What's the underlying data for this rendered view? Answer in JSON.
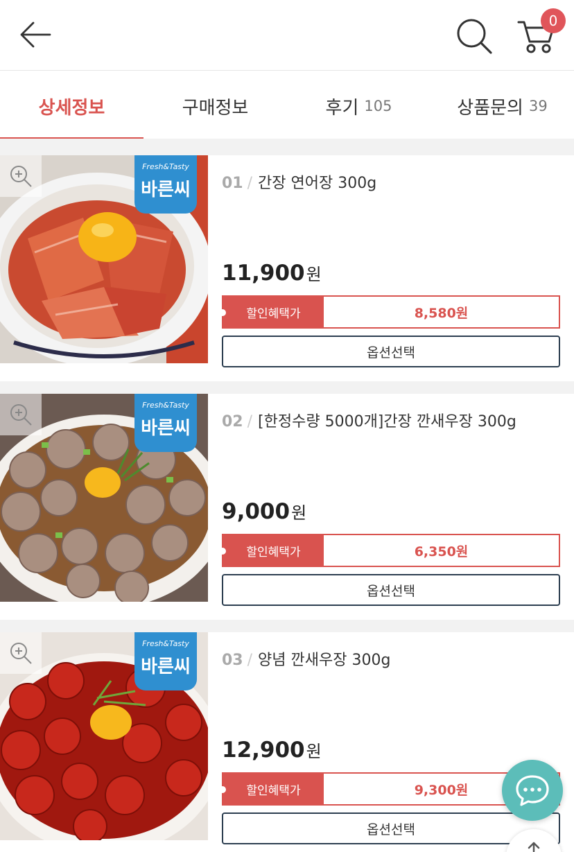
{
  "header": {
    "back_icon": "arrow-left-icon",
    "search_icon": "search-icon",
    "cart_icon": "cart-icon",
    "cart_count": "0"
  },
  "tabs": [
    {
      "label": "상세정보",
      "count": ""
    },
    {
      "label": "구매정보",
      "count": ""
    },
    {
      "label": "후기",
      "count": "105"
    },
    {
      "label": "상품문의",
      "count": "39"
    }
  ],
  "colors": {
    "accent": "#d9534f",
    "chat": "#5cbdb9",
    "brand": "#2f8fd0"
  },
  "products": [
    {
      "num": "01",
      "name": "간장 연어장 300g",
      "price": "11,900",
      "won": "원",
      "discount_label": "할인혜택가",
      "discount_price": "8,580원",
      "option_label": "옵션선택"
    },
    {
      "num": "02",
      "name": "[한정수량 5000개]간장 깐새우장 300g",
      "price": "9,000",
      "won": "원",
      "discount_label": "할인혜택가",
      "discount_price": "6,350원",
      "option_label": "옵션선택"
    },
    {
      "num": "03",
      "name": "양념 깐새우장 300g",
      "price": "12,900",
      "won": "원",
      "discount_label": "할인혜택가",
      "discount_price": "9,300원",
      "option_label": "옵션선택"
    }
  ],
  "brand_badge": {
    "small": "Fresh&Tasty",
    "big": "바른씨"
  },
  "floating": {
    "chat_icon": "chat-bubble-icon",
    "top_icon": "arrow-up-icon"
  }
}
